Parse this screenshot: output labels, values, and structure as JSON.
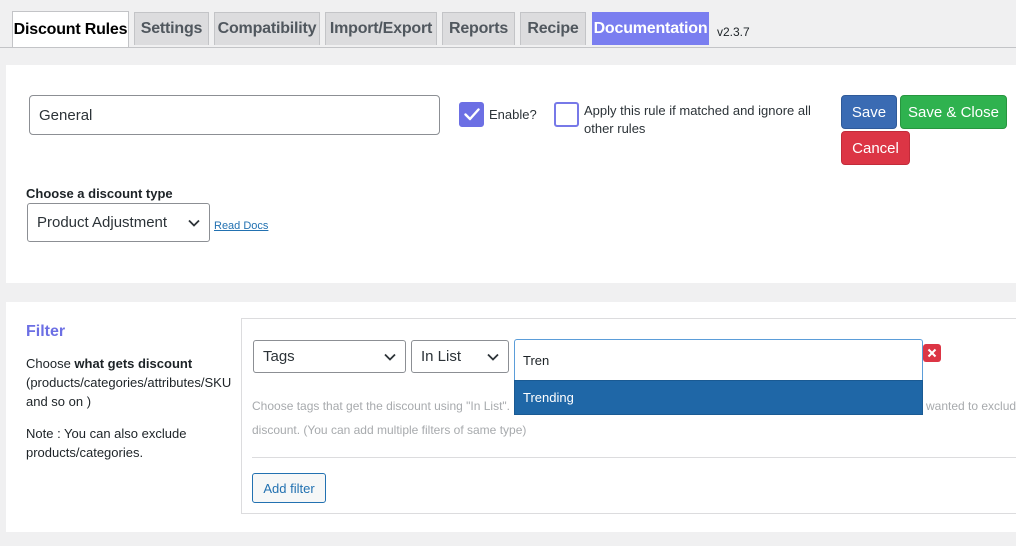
{
  "tabs": [
    {
      "label": "Discount Rules",
      "active": true
    },
    {
      "label": "Settings"
    },
    {
      "label": "Compatibility"
    },
    {
      "label": "Import/Export"
    },
    {
      "label": "Reports"
    },
    {
      "label": "Recipe"
    },
    {
      "label": "Documentation",
      "highlight_color": "#7a7ef0"
    }
  ],
  "version": "v2.3.7",
  "rule": {
    "title": "General",
    "enable_label": "Enable?",
    "enabled": true,
    "exclusive_label": "Apply this rule if matched and ignore all other rules",
    "exclusive_checked": false
  },
  "actions": {
    "save": "Save",
    "save_close": "Save & Close",
    "cancel": "Cancel",
    "colors": {
      "save": "#3a6bb3",
      "save_close": "#2fb24f",
      "cancel": "#dc3545"
    }
  },
  "discount_type": {
    "label": "Choose a discount type",
    "selected": "Product Adjustment",
    "read_docs": "Read Docs"
  },
  "filter": {
    "title": "Filter",
    "desc_pre": "Choose ",
    "desc_bold": "what gets discount",
    "desc_post": " (products/categories/attributes/SKU and so on )",
    "note": "Note : You can also exclude products/categories.",
    "type_selected": "Tags",
    "method_selected": "In List",
    "search_value": "Tren",
    "dropdown_option": "Trending",
    "hint_part1": "Choose tags that get the discount using \"In List\".",
    "hint_part2": "wanted to exclud",
    "hint_part3": "discount. (You can add multiple filters of same type)",
    "add_filter": "Add filter"
  },
  "icons": {
    "checkbox": "check-icon",
    "remove": "close-icon",
    "select": "chevron-down-icon"
  }
}
